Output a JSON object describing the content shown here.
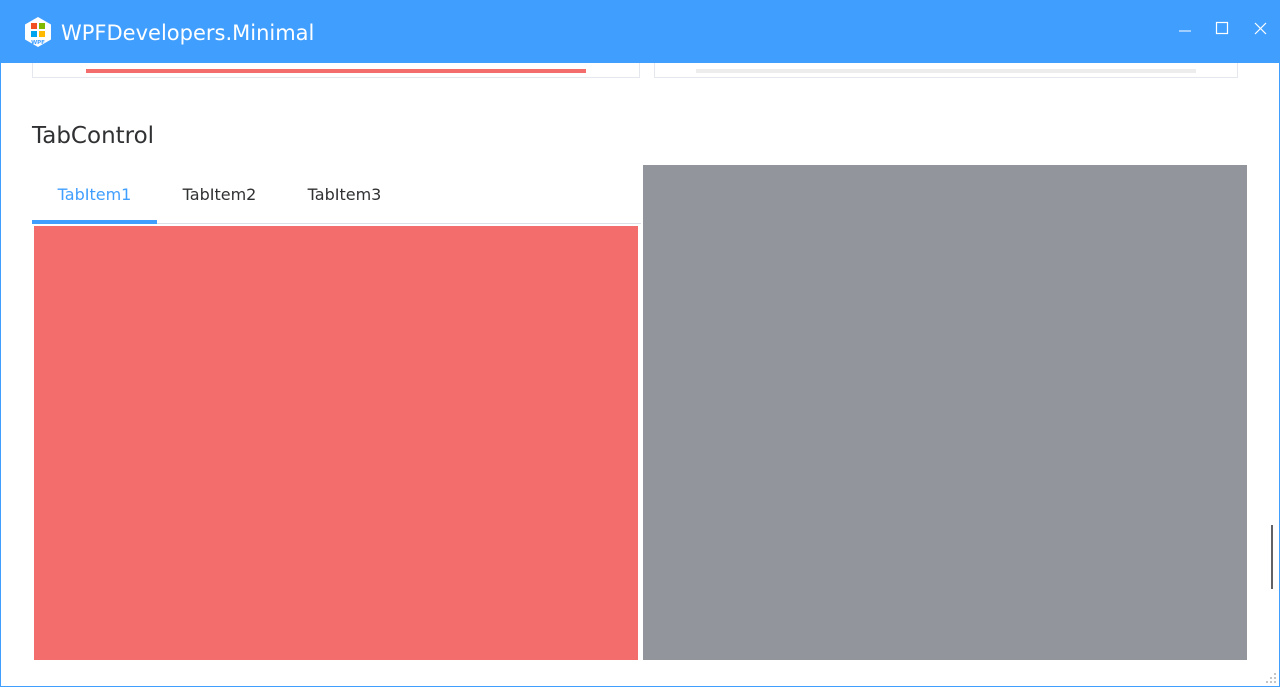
{
  "window": {
    "title": "WPFDevelopers.Minimal",
    "logo_text": "WPF",
    "accent_color": "#409eff",
    "controls": {
      "minimize_icon": "minimize-icon",
      "maximize_icon": "maximize-icon",
      "close_icon": "close-icon"
    }
  },
  "progress_cards": [
    {
      "progress_color": "#f46d6d",
      "value_percent": 100
    },
    {
      "progress_color": "#ededed",
      "value_percent": 0
    }
  ],
  "tab_control": {
    "heading": "TabControl",
    "tabs": [
      {
        "label": "TabItem1",
        "selected": true
      },
      {
        "label": "TabItem2",
        "selected": false
      },
      {
        "label": "TabItem3",
        "selected": false
      }
    ],
    "panel_color": "#f46d6d",
    "side_panel_color": "#92959c"
  }
}
